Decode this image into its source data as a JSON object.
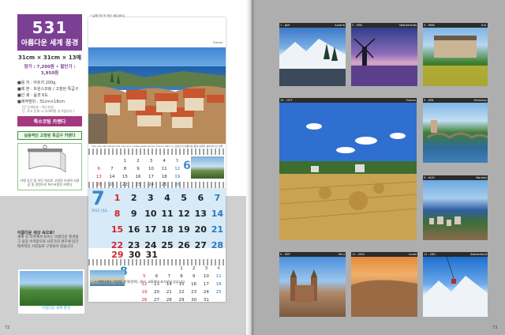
{
  "product": {
    "number": "531",
    "name": "아름다운 세계 풍경",
    "size": "31cm × 31cm × 13매",
    "price": "정가 : 7,200원 • 할인가 : 3,950원",
    "specs": [
      "■용 지 : 아트지 200g",
      "■제 본 : 트윈스프링 / 고정된 특급구",
      "■인 쇄 : 옵셋 6도",
      "■제작범위 : 31cm×18cm"
    ],
    "spec_subnotes": [
      "(단 인쇄부분 : 박스포장,",
      "단, 로고 인쇄 시 3,000원 추가됩니다.)"
    ],
    "badge_coating": "특수코팅 카렌다",
    "badge_clip": "실용적인 고정된 특급구 카렌다",
    "clip_note": "카렌 상단 및 하단 처리로 고정된 유리며 사용감 및 양면으로 특수코팅된 카렌다"
  },
  "promo": {
    "title": "이름다운 세상 속으로!",
    "body": "세계 각 지역에서 보이는 아름다운 풍경을 그 웅장 수려함으로 사진가의 렌즈에 담긴 매혹적인 사진들로 구성되어 있습니다."
  },
  "mini_cover_title": "아름다운 세계 풍경",
  "calendar": {
    "notes": [
      "• 날짜선의 박 혁신 세트(BIG)",
      "• 인쇄된 박 혁신 자유 조립"
    ],
    "photo_location": "France",
    "caption": "The rook will refresh the rant and create great places, France (6P 4 1) 프랑스의 아름다운 풍경 여행지 중에 하나인 생폴 드 방스",
    "month_june": {
      "number": "6",
      "rows": [
        [
          "",
          "",
          "1",
          "2",
          "3",
          "4",
          "5"
        ],
        [
          "6",
          "7",
          "8",
          "9",
          "10",
          "11",
          "12"
        ],
        [
          "13",
          "14",
          "15",
          "16",
          "17",
          "18",
          "19"
        ],
        [
          "20",
          "21",
          "22",
          "23",
          "24",
          "25",
          "26"
        ],
        [
          "27",
          "28",
          "29",
          "30",
          "",
          "",
          ""
        ]
      ]
    },
    "month_july": {
      "number": "7",
      "sub": "2012 / JUL",
      "rows": [
        [
          "1",
          "2",
          "3",
          "4",
          "5",
          "6",
          "7"
        ],
        [
          "8",
          "9",
          "10",
          "11",
          "12",
          "13",
          "14"
        ],
        [
          "15",
          "16",
          "17",
          "18",
          "19",
          "20",
          "21"
        ],
        [
          "22",
          "23",
          "24",
          "25",
          "26",
          "27",
          "28"
        ],
        [
          "29",
          "30",
          "31",
          "",
          "",
          "",
          ""
        ]
      ]
    },
    "month_august": {
      "number": "8",
      "rows": [
        [
          "",
          "",
          "",
          "1",
          "2",
          "3",
          "4"
        ],
        [
          "5",
          "6",
          "7",
          "8",
          "9",
          "10",
          "11"
        ],
        [
          "12",
          "13",
          "14",
          "15",
          "16",
          "17",
          "18"
        ],
        [
          "19",
          "20",
          "21",
          "22",
          "23",
          "24",
          "25"
        ],
        [
          "26",
          "27",
          "28",
          "29",
          "30",
          "31",
          ""
        ]
      ]
    },
    "footer": "• 카렌다에는 기념일, 음력(양력), 절기, 교통력이 표기되어 있습니다."
  },
  "page_numbers": {
    "left": "72",
    "right": "73"
  },
  "tiles": [
    {
      "month": "1 - JAN",
      "place": "Austria"
    },
    {
      "month": "2 - FEB",
      "place": "Netherlands"
    },
    {
      "month": "3 - MAR",
      "place": "U.K."
    },
    {
      "month": "10 - OCT",
      "place": "France"
    },
    {
      "month": "5 - JUN",
      "place": "Germany"
    },
    {
      "month": "5 - AUG",
      "place": "Norway"
    },
    {
      "month": "9 - SEP",
      "place": "Peru"
    },
    {
      "month": "11 - NOV",
      "place": "Israel"
    },
    {
      "month": "12 - DEC",
      "place": "Switzerland"
    }
  ],
  "colors": {
    "brand": "#7b3f93",
    "accent_pink": "#a4377d",
    "accent_blue": "#3a86c4"
  }
}
